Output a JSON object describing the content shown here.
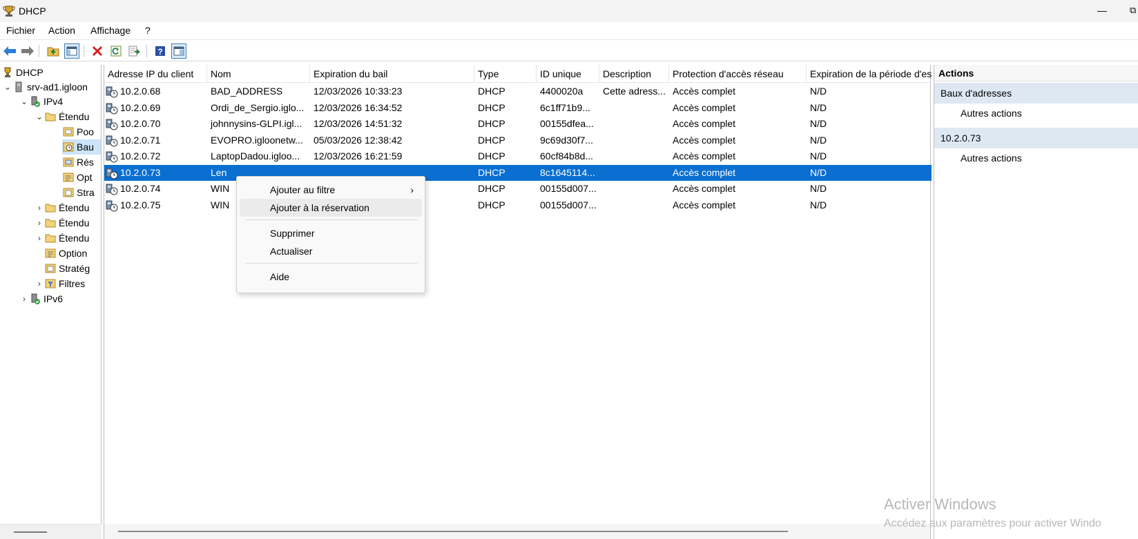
{
  "window": {
    "title": "DHCP",
    "minimize_glyph": "—",
    "restore_glyph": "⧉"
  },
  "menu": [
    "Fichier",
    "Action",
    "Affichage",
    "?"
  ],
  "tree": {
    "items": [
      {
        "label": "DHCP"
      },
      {
        "label": "srv-ad1.igloon"
      },
      {
        "label": "IPv4"
      },
      {
        "label": "Étendu"
      },
      {
        "label": "Poo"
      },
      {
        "label": "Bau"
      },
      {
        "label": "Rés"
      },
      {
        "label": "Opt"
      },
      {
        "label": "Stra"
      },
      {
        "label": "Étendu"
      },
      {
        "label": "Étendu"
      },
      {
        "label": "Étendu"
      },
      {
        "label": "Option"
      },
      {
        "label": "Stratég"
      },
      {
        "label": "Filtres"
      },
      {
        "label": "IPv6"
      }
    ]
  },
  "list": {
    "columns": [
      "Adresse IP du client",
      "Nom",
      "Expiration du bail",
      "Type",
      "ID unique",
      "Description",
      "Protection d'accès réseau",
      "Expiration de la période d'essa"
    ],
    "rows": [
      [
        "10.2.0.68",
        "BAD_ADDRESS",
        "12/03/2026 10:33:23",
        "DHCP",
        "4400020a",
        "Cette adress...",
        "Accès complet",
        "N/D"
      ],
      [
        "10.2.0.69",
        "Ordi_de_Sergio.iglo...",
        "12/03/2026 16:34:52",
        "DHCP",
        "6c1ff71b9...",
        "",
        "Accès complet",
        "N/D"
      ],
      [
        "10.2.0.70",
        "johnnysins-GLPI.igl...",
        "12/03/2026 14:51:32",
        "DHCP",
        "00155dfea...",
        "",
        "Accès complet",
        "N/D"
      ],
      [
        "10.2.0.71",
        "EVOPRO.igloonetw...",
        "05/03/2026 12:38:42",
        "DHCP",
        "9c69d30f7...",
        "",
        "Accès complet",
        "N/D"
      ],
      [
        "10.2.0.72",
        "LaptopDadou.igloo...",
        "12/03/2026 16:21:59",
        "DHCP",
        "60cf84b8d...",
        "",
        "Accès complet",
        "N/D"
      ],
      [
        "10.2.0.73",
        "Len",
        "",
        "DHCP",
        "8c1645114...",
        "",
        "Accès complet",
        "N/D"
      ],
      [
        "10.2.0.74",
        "WIN",
        "",
        "DHCP",
        "00155d007...",
        "",
        "Accès complet",
        "N/D"
      ],
      [
        "10.2.0.75",
        "WIN",
        "",
        "DHCP",
        "00155d007...",
        "",
        "Accès complet",
        "N/D"
      ]
    ]
  },
  "actions": {
    "title": "Actions",
    "sections": [
      {
        "header": "Baux d'adresses",
        "link": "Autres actions"
      },
      {
        "header": "10.2.0.73",
        "link": "Autres actions"
      }
    ]
  },
  "context_menu": {
    "items": [
      "Ajouter au filtre",
      "Ajouter à la réservation",
      "Supprimer",
      "Actualiser",
      "Aide"
    ],
    "submenu_arrow": "›"
  },
  "watermark": {
    "line1": "Activer Windows",
    "line2": "Accédez aux paramètres pour activer Windo"
  },
  "colors": {
    "selection": "#0a6fd1",
    "action_section": "#dde8f3"
  }
}
